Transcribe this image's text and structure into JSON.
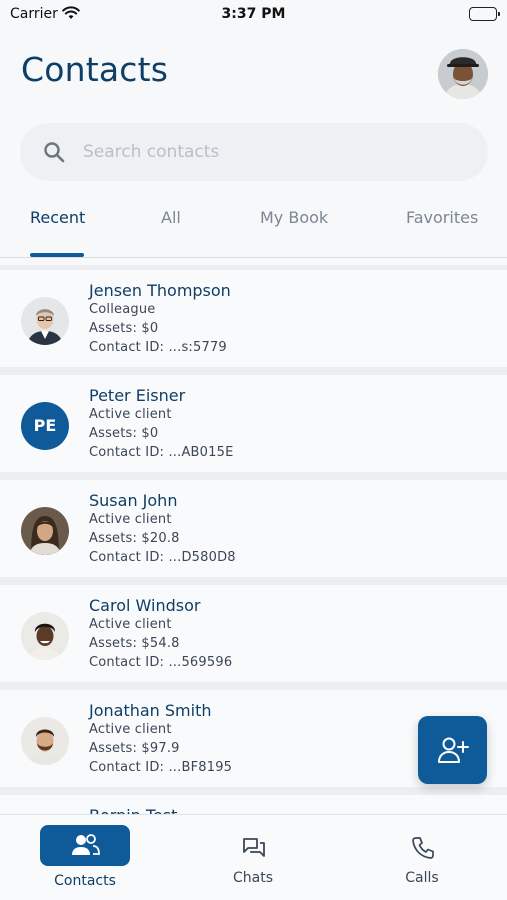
{
  "status_bar": {
    "carrier": "Carrier",
    "time": "3:37 PM"
  },
  "header": {
    "title": "Contacts"
  },
  "search": {
    "placeholder": "Search contacts",
    "value": ""
  },
  "tabs": [
    {
      "label": "Recent",
      "active": true
    },
    {
      "label": "All",
      "active": false
    },
    {
      "label": "My Book",
      "active": false
    },
    {
      "label": "Favorites",
      "active": false
    }
  ],
  "contacts": [
    {
      "name": "Jensen Thompson",
      "type": "Colleague",
      "assets": "Assets: $0",
      "contact_id": "Contact ID: ...s:5779",
      "avatar": "photo"
    },
    {
      "name": "Peter Eisner",
      "type": "Active client",
      "assets": "Assets: $0",
      "contact_id": "Contact ID: ...AB015E",
      "avatar": "initials",
      "initials": "PE"
    },
    {
      "name": "Susan John",
      "type": "Active client",
      "assets": "Assets: $20.8",
      "contact_id": "Contact ID: ...D580D8",
      "avatar": "photo"
    },
    {
      "name": "Carol Windsor",
      "type": "Active client",
      "assets": "Assets: $54.8",
      "contact_id": "Contact ID: ...569596",
      "avatar": "photo"
    },
    {
      "name": "Jonathan Smith",
      "type": "Active client",
      "assets": "Assets: $97.9",
      "contact_id": "Contact ID: ...BF8195",
      "avatar": "photo"
    },
    {
      "name": "Bornin Test",
      "avatar": "initials",
      "initials": ""
    }
  ],
  "fab": {
    "icon": "add-contact-icon"
  },
  "bottom_nav": [
    {
      "label": "Contacts",
      "icon": "contacts-icon",
      "active": true
    },
    {
      "label": "Chats",
      "icon": "chats-icon",
      "active": false
    },
    {
      "label": "Calls",
      "icon": "phone-icon",
      "active": false
    }
  ],
  "colors": {
    "primary": "#0f5b99",
    "title": "#0f3e66",
    "background": "#f7f8fa"
  }
}
